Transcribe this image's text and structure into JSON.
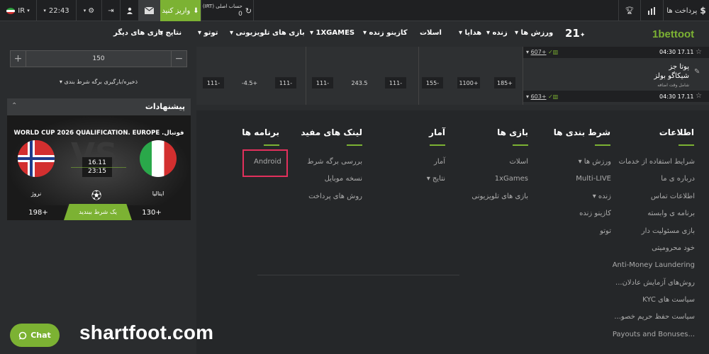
{
  "topbar": {
    "lang": "IR",
    "time": "22:43",
    "deposit_label": "واریز کنید",
    "account_label": "حساب اصلی (IRT)",
    "balance": "0",
    "payments_label": "پرداخت ها"
  },
  "nav": {
    "logo": "1bettoot",
    "tag21": "21",
    "items": [
      "ورزش ها",
      "زنده",
      "هدایا",
      "اسلات",
      "کازینو زنده",
      "1XGAMES",
      "بازی های تلویزیونی",
      "توتو",
      "نتایج",
      "بازی های دیگر"
    ]
  },
  "sidebar": {
    "stake_value": "150",
    "save_label": "ذخیره/بارگیری برگه شرط بندی",
    "offers_title": "پیشنهادات",
    "match_league": "WORLD CUP 2026 QUALIFICATION. EUROPE .فوتبال",
    "team_home": "ایتالیا",
    "team_away": "نروژ",
    "match_date": "16.11",
    "match_time": "23:15",
    "vs": "VS",
    "odd_home": "130+",
    "odd_away": "198+",
    "bet_label": "یک شرط ببندید"
  },
  "odds": {
    "row1_time": "04:30 17.11",
    "row1_count": "607+",
    "team1": "پوتا جز",
    "team2": "شیکاگو بولز",
    "note": "شامل وقت اضافه",
    "row2_time": "04:30 17.11",
    "row2_count": "603+",
    "values": [
      "185+",
      "1100+",
      "155-",
      "111-",
      "243.5",
      "111-",
      "111-",
      "-4.5+",
      "111-"
    ]
  },
  "footer": {
    "columns": [
      {
        "title": "اطلاعات",
        "links": [
          "شرایط استفاده از خدمات",
          "درباره ی ما",
          "اطلاعات تماس",
          "برنامه ی وابسته",
          "بازی مسئولیت دار",
          "خود محرومیتی",
          "Anti-Money Laundering",
          "روش‌های آزمایش عادلان...",
          "سیاست های KYC",
          "سیاست حفظ حریم خصو...",
          "Payouts and Bonuses..."
        ]
      },
      {
        "title": "شرط بندی ها",
        "links": [
          "ورزش ها",
          "Multi-LIVE",
          "زنده",
          "کازینو زنده",
          "توتو"
        ]
      },
      {
        "title": "بازی ها",
        "links": [
          "اسلات",
          "1xGames",
          "بازی های تلویزیونی"
        ]
      },
      {
        "title": "آمار",
        "links": [
          "آمار",
          "نتایج"
        ]
      },
      {
        "title": "لینک های مفید",
        "links": [
          "بررسی برگه شرط",
          "نسخه موبایل",
          "روش های پرداخت"
        ]
      },
      {
        "title": "برنامه ها",
        "links": [
          "Android"
        ]
      }
    ]
  },
  "chat_label": "Chat",
  "watermark": "shartfoot.com",
  "colors": {
    "accent": "#7cb233",
    "highlight": "#e2305c",
    "bg": "#2a2c2e"
  }
}
